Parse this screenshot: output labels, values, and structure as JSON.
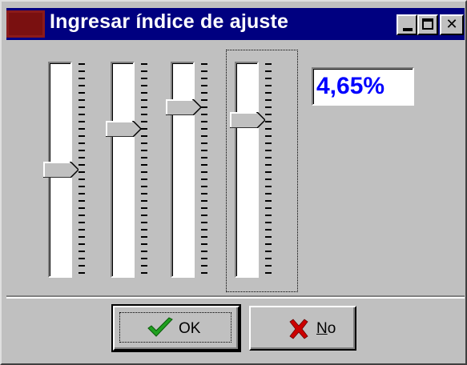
{
  "window": {
    "title": "Ingresar índice de ajuste",
    "minimize_label": "_",
    "close_label": "✕"
  },
  "sliders": [
    {
      "id": "slider-1",
      "level_fraction": 0.5
    },
    {
      "id": "slider-2",
      "level_fraction": 0.31
    },
    {
      "id": "slider-3",
      "level_fraction": 0.21
    },
    {
      "id": "slider-4",
      "level_fraction": 0.27
    }
  ],
  "value_display": "4,65%",
  "buttons": {
    "ok_label": "OK",
    "no_label_underlined": "N",
    "no_label_rest": "o"
  },
  "colors": {
    "titlebar": "#000080",
    "window_bg": "#c0c0c0",
    "value_text": "#0000ff",
    "ok_check": "#1fa01f",
    "no_cross": "#cc0000"
  },
  "icons": {
    "app": "app-icon",
    "ok": "checkmark-icon",
    "no": "red-x-icon"
  }
}
